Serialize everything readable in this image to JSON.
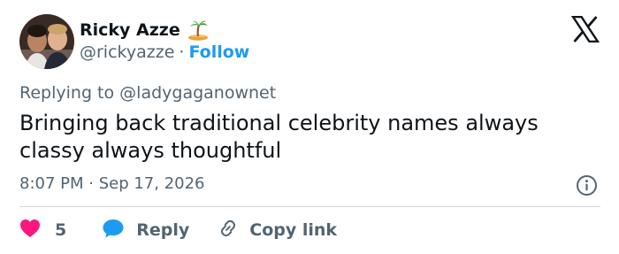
{
  "author": {
    "display_name": "Ricky Azze",
    "badge_icon": "desert-island-icon",
    "handle": "@rickyazze",
    "separator": "·",
    "follow_label": "Follow"
  },
  "brand": {
    "icon": "x-logo-icon"
  },
  "tweet": {
    "replying_prefix": "Replying to",
    "replying_to": "@ladygaganownet",
    "text": "Bringing back traditional celebrity names always classy always thoughtful",
    "timestamp": "8:07 PM · Sep 17, 2026"
  },
  "actions": {
    "like_count": "5",
    "reply_label": "Reply",
    "copy_link_label": "Copy link"
  },
  "colors": {
    "accent": "#1d9bf0",
    "like": "#f91880",
    "text": "#0f1419",
    "secondary": "#536471",
    "divider": "#cfd9de"
  }
}
